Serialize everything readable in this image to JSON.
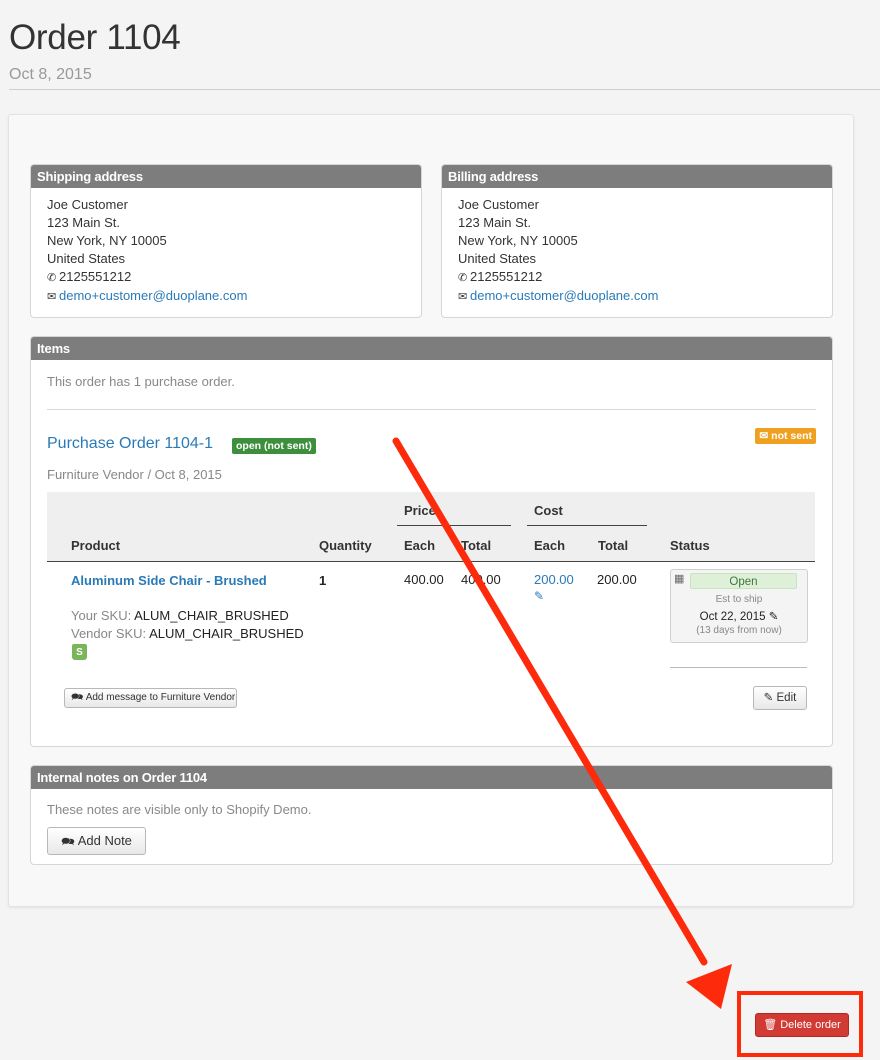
{
  "header": {
    "title": "Order 1104",
    "date": "Oct 8, 2015"
  },
  "shipping": {
    "heading": "Shipping address",
    "name": "Joe Customer",
    "street": "123 Main St.",
    "city": "New York, NY 10005",
    "country": "United States",
    "phone": "2125551212",
    "email": "demo+customer@duoplane.com"
  },
  "billing": {
    "heading": "Billing address",
    "name": "Joe Customer",
    "street": "123 Main St.",
    "city": "New York, NY 10005",
    "country": "United States",
    "phone": "2125551212",
    "email": "demo+customer@duoplane.com"
  },
  "items": {
    "heading": "Items",
    "summary": "This order has 1 purchase order.",
    "po": {
      "title": "Purchase Order 1104-1",
      "status_badge": "open (not sent)",
      "sent_badge": "not sent",
      "vendor_line": "Furniture Vendor / Oct 8, 2015"
    },
    "table": {
      "col_product": "Product",
      "col_quantity": "Quantity",
      "group_price": "Price",
      "group_cost": "Cost",
      "col_each": "Each",
      "col_total": "Total",
      "col_status": "Status"
    },
    "row": {
      "product": "Aluminum Side Chair - Brushed",
      "quantity": "1",
      "price_each": "400.00",
      "price_total": "400.00",
      "cost_each": "200.00",
      "cost_total": "200.00",
      "your_sku_label": "Your SKU:",
      "your_sku": "ALUM_CHAIR_BRUSHED",
      "vendor_sku_label": "Vendor SKU:",
      "vendor_sku": "ALUM_CHAIR_BRUSHED",
      "status": "Open",
      "est_label": "Est to ship",
      "est_date": "Oct 22, 2015",
      "est_relative": "(13 days from now)"
    },
    "add_message_label": "Add message to Furniture Vendor",
    "edit_label": "Edit"
  },
  "notes": {
    "heading": "Internal notes on Order 1104",
    "description": "These notes are visible only to Shopify Demo.",
    "add_note_label": "Add Note"
  },
  "delete_label": "Delete order",
  "icons": [
    "phone-icon",
    "envelope-icon",
    "pencil-icon",
    "calendar-icon",
    "shopify-bag-icon",
    "comment-icon",
    "trash-icon"
  ],
  "colors": {
    "accent": "#2a7ab8",
    "panel_header": "#7d7d7d",
    "open_badge": "#3d8f3d",
    "not_sent_badge": "#f0a020",
    "danger": "#d23a34",
    "annotation": "#fe2a0c"
  }
}
